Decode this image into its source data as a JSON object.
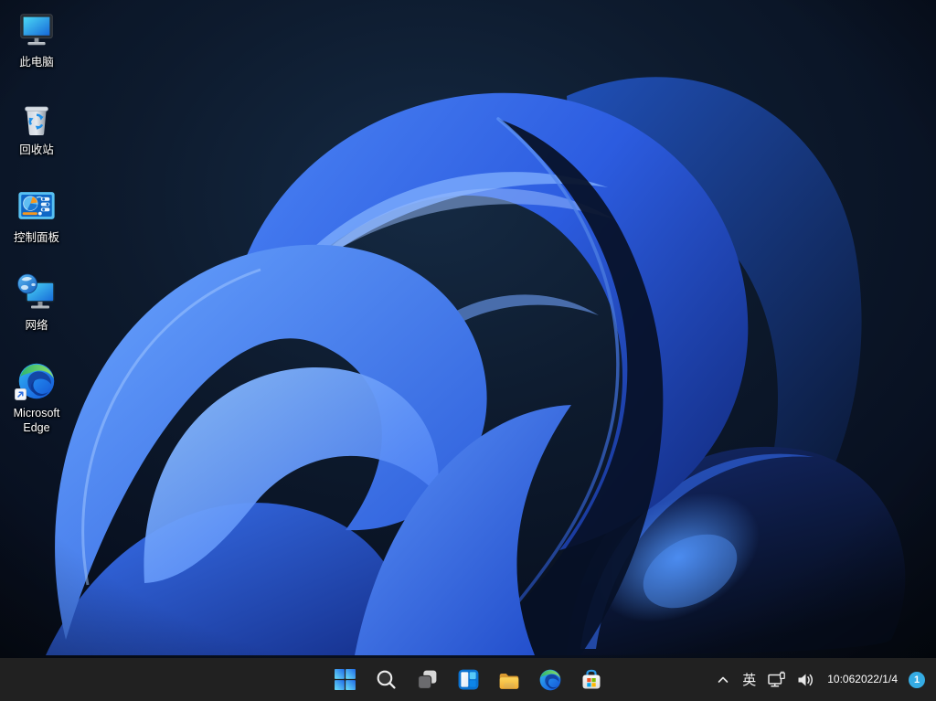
{
  "desktop": {
    "icons": [
      {
        "id": "this-pc",
        "label": "此电脑",
        "icon": "monitor-icon"
      },
      {
        "id": "recycle-bin",
        "label": "回收站",
        "icon": "recycle-bin-icon"
      },
      {
        "id": "control-panel",
        "label": "控制面板",
        "icon": "control-panel-icon"
      },
      {
        "id": "network",
        "label": "网络",
        "icon": "network-globe-monitor-icon"
      },
      {
        "id": "microsoft-edge",
        "label": "Microsoft Edge",
        "icon": "edge-browser-icon"
      }
    ]
  },
  "taskbar": {
    "buttons": [
      {
        "id": "start",
        "icon": "windows-start-icon"
      },
      {
        "id": "search",
        "icon": "search-icon"
      },
      {
        "id": "task-view",
        "icon": "task-view-icon"
      },
      {
        "id": "widgets",
        "icon": "widgets-icon"
      },
      {
        "id": "file-explorer",
        "icon": "folder-icon"
      },
      {
        "id": "edge",
        "icon": "edge-browser-icon"
      },
      {
        "id": "store",
        "icon": "microsoft-store-icon"
      }
    ],
    "tray": {
      "chevron_icon": "chevron-up-icon",
      "ime_indicator": "英",
      "network_icon": "wired-network-icon",
      "volume_icon": "speaker-icon",
      "time": "10:06",
      "date": "2022/1/4",
      "notification_badge_count": "1"
    }
  },
  "colors": {
    "taskbar_bg": "#212121",
    "badge_blue": "#35ace4",
    "bloom_bright": "#4a86f7",
    "bloom_deep": "#0a1a3a",
    "bg_dark": "#060c16"
  }
}
